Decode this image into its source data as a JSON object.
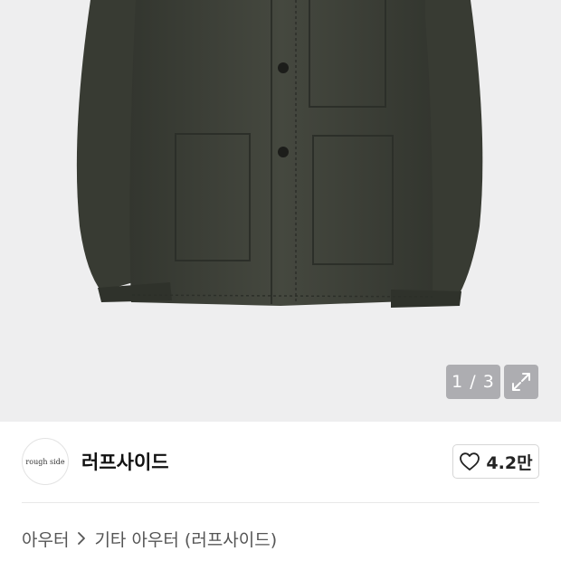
{
  "gallery": {
    "current_page": "1",
    "separator": "/",
    "total_pages": "3",
    "counter_text": "1 / 3",
    "product_image": "olive-green-work-jacket-photo",
    "expand_icon": "expand-arrows-icon",
    "background_color": "#eeeeef"
  },
  "brand": {
    "logo_text": "rough side",
    "name": "러프사이드"
  },
  "like": {
    "icon": "heart-icon",
    "count": "4.2만"
  },
  "breadcrumb": {
    "items": [
      "아우터",
      "기타 아우터 (러프사이드)"
    ],
    "separator_icon": "chevron-right-icon"
  },
  "colors": {
    "jacket": "#3d4038",
    "text_primary": "#111111",
    "text_secondary": "#555555"
  }
}
